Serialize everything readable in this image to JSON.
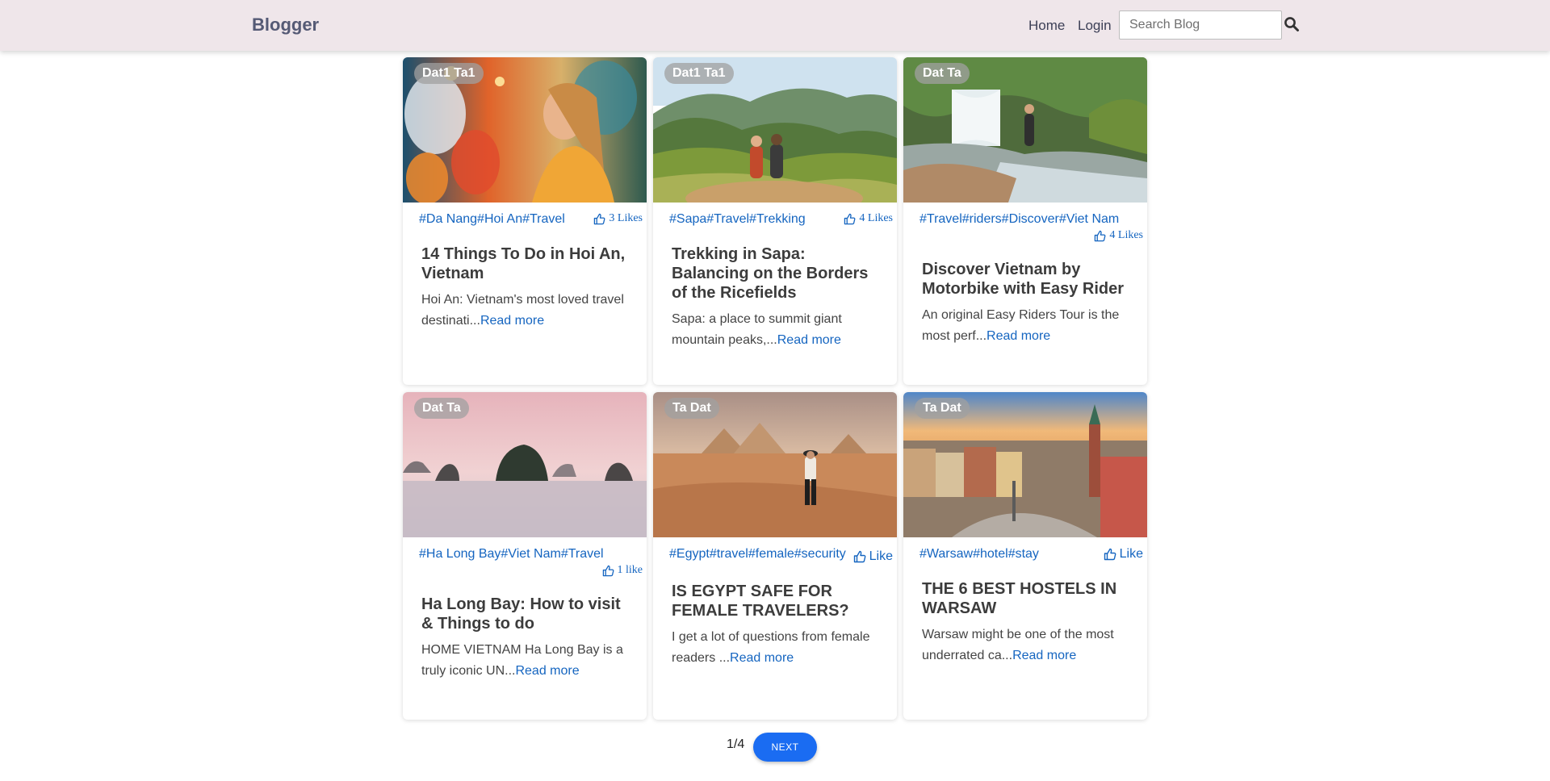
{
  "header": {
    "brand": "Blogger",
    "nav": {
      "home": "Home",
      "login": "Login"
    },
    "search_placeholder": "Search Blog",
    "search_icon": "search-icon"
  },
  "posts": [
    {
      "author": "Dat1 Ta1",
      "tags": [
        "#Da Nang",
        "#Hoi An",
        "#Travel"
      ],
      "likes": "3 Likes",
      "title": "14 Things To Do in Hoi An, Vietnam",
      "excerpt": "Hoi An: Vietnam's most loved travel destinati...",
      "read_more": "Read more"
    },
    {
      "author": "Dat1 Ta1",
      "tags": [
        "#Sapa",
        "#Travel",
        "#Trekking"
      ],
      "likes": "4 Likes",
      "title": "Trekking in Sapa: Balancing on the Borders of the Ricefields",
      "excerpt": "Sapa: a place to summit giant mountain peaks,...",
      "read_more": "Read more"
    },
    {
      "author": "Dat Ta",
      "tags": [
        "#Travel",
        "#riders",
        "#Discover",
        "#Viet Nam"
      ],
      "likes": "4 Likes",
      "title": "Discover Vietnam by Motorbike with Easy Rider",
      "excerpt": "An original Easy Riders Tour is the most perf...",
      "read_more": "Read more"
    },
    {
      "author": "Dat Ta",
      "tags": [
        "#Ha Long Bay",
        "#Viet Nam",
        "#Travel"
      ],
      "likes": "1 like",
      "title": "Ha Long Bay: How to visit & Things to do",
      "excerpt": "HOME VIETNAM Ha Long Bay is a truly iconic UN...",
      "read_more": "Read more"
    },
    {
      "author": "Ta Dat",
      "tags": [
        "#Egypt",
        "#travel",
        "#female",
        "#security"
      ],
      "likes": "Like",
      "title": "IS EGYPT SAFE FOR FEMALE TRAVELERS?",
      "excerpt": "I get a lot of questions from female readers ...",
      "read_more": "Read more"
    },
    {
      "author": "Ta Dat",
      "tags": [
        "#Warsaw",
        "#hotel",
        "#stay"
      ],
      "likes": "Like",
      "title": "THE 6 BEST HOSTELS IN WARSAW",
      "excerpt": "Warsaw might be one of the most underrated ca...",
      "read_more": "Read more"
    }
  ],
  "pagination": {
    "current": "1/4",
    "next_label": "NEXT"
  },
  "colors": {
    "header_bg": "#efe6ea",
    "link": "#1565c0",
    "primary_button": "#1a6cf2"
  }
}
